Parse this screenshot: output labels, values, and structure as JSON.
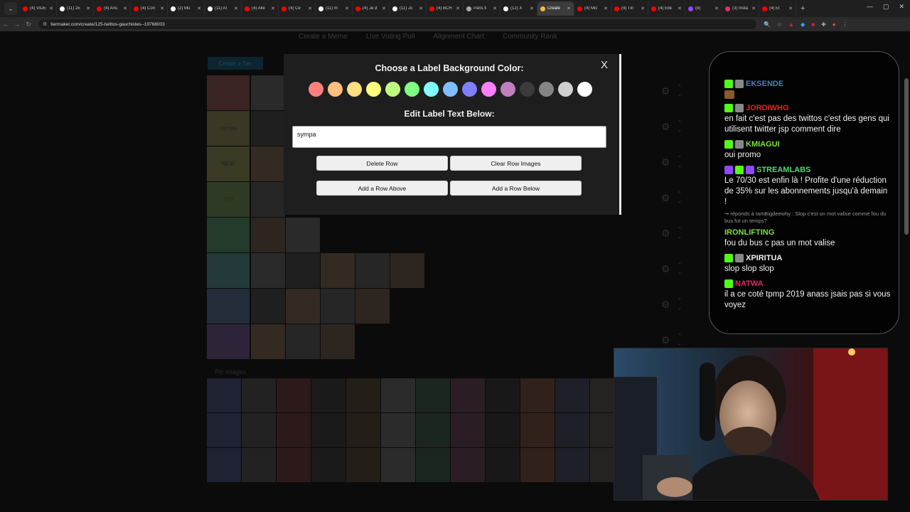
{
  "browser": {
    "tabs": [
      {
        "label": "(4) VIDE",
        "fav": "#ff0000"
      },
      {
        "label": "(11) 2E",
        "fav": "#ffffff"
      },
      {
        "label": "(4) Ans",
        "fav": "#ff0000"
      },
      {
        "label": "(4) Con",
        "fav": "#ff0000"
      },
      {
        "label": "(2) Mu",
        "fav": "#ffffff"
      },
      {
        "label": "(11) Al",
        "fav": "#ffffff"
      },
      {
        "label": "(4) Alle",
        "fav": "#ff0000"
      },
      {
        "label": "(4) Ce",
        "fav": "#ff0000"
      },
      {
        "label": "(11) m",
        "fav": "#ffffff"
      },
      {
        "label": "(4) Je d",
        "fav": "#ff0000"
      },
      {
        "label": "(11) Jo",
        "fav": "#ffffff"
      },
      {
        "label": "(4) BCH",
        "fav": "#ff0000"
      },
      {
        "label": "Paris fi",
        "fav": "#aaaaaa"
      },
      {
        "label": "(12) X",
        "fav": "#ffffff"
      },
      {
        "label": "Create",
        "fav": "#e8c03a",
        "active": true
      },
      {
        "label": "(4) Mic",
        "fav": "#ff0000"
      },
      {
        "label": "(4) Tin",
        "fav": "#ff0000"
      },
      {
        "label": "(4) Elle",
        "fav": "#ff0000"
      },
      {
        "label": "(8) ",
        "fav": "#9146ff"
      },
      {
        "label": "(3) Insta",
        "fav": "#e1306c"
      },
      {
        "label": "(4) Et",
        "fav": "#ff0000"
      }
    ],
    "new_tab": "+",
    "url": "tiermaker.com/create/125-twittos-gauchistes--19768003"
  },
  "page": {
    "top_links": [
      "Create a Meme",
      "Live Voting Poll",
      "Alignment Chart",
      "Community Rank"
    ],
    "create_tier_label": "Create a Tier",
    "pool_title": "Pic images"
  },
  "tiers": [
    {
      "label": "",
      "color": "#ff7f7f"
    },
    {
      "label": "sympa",
      "color": "#ffdf7f"
    },
    {
      "label": "NEW",
      "color": "#ffff7f"
    },
    {
      "label": "???",
      "color": "#bfff7f"
    },
    {
      "label": "",
      "color": "#7fff7f"
    },
    {
      "label": "",
      "color": "#7fffff"
    },
    {
      "label": "",
      "color": "#7fbfff"
    },
    {
      "label": "",
      "color": "#bf7fff"
    }
  ],
  "modal": {
    "close": "X",
    "title": "Choose a Label Background Color:",
    "edit_title": "Edit Label Text Below:",
    "label_value": "sympa",
    "buttons": {
      "delete_row": "Delete Row",
      "clear_images": "Clear Row Images",
      "add_above": "Add a Row Above",
      "add_below": "Add a Row Below"
    },
    "colors": [
      "#ff7f7f",
      "#ffbf7f",
      "#ffdf7f",
      "#ffff7f",
      "#bfff7f",
      "#7fff7f",
      "#7fffff",
      "#7fbfff",
      "#7f7fff",
      "#ff7fff",
      "#bf7fbf",
      "#3b3b3b",
      "#858585",
      "#cfcfcf",
      "#ffffff"
    ]
  },
  "chat": {
    "messages": [
      {
        "user": "EKSENDE",
        "color": "#4a7fc4",
        "badges": [
          "#53fc18",
          "#888888"
        ],
        "text": "",
        "emote": true
      },
      {
        "user": "JORDIWHO",
        "color": "#e02424",
        "badges": [
          "#53fc18",
          "#888888"
        ],
        "text": "en fait c'est pas des twittos c'est des gens qui utilisent twitter jsp comment dire"
      },
      {
        "user": "KMIAGUI",
        "color": "#79e23a",
        "badges": [
          "#53fc18",
          "#888888"
        ],
        "text": "oui promo"
      },
      {
        "user": "STREAMLABS",
        "color": "#5bd27a",
        "badges": [
          "#9146ff",
          "#53fc18",
          "#9146ff"
        ],
        "text": "Le 70/30 est enfin là ! Profite d'une réduction de 35% sur les abonnements jusqu'à demain !"
      },
      {
        "reply": "↪ réponds à IamBigdeewhy : Slop c'est un mot valise comme fou du bus fut un temps?",
        "user": "IRONLIFTING",
        "color": "#7be23a",
        "badges": [],
        "text": "fou du bus c pas un mot valise"
      },
      {
        "user": "XPIRITUA",
        "color": "#f2f2f2",
        "badges": [
          "#53fc18",
          "#888888"
        ],
        "text": "slop slop slop"
      },
      {
        "user": "NATWA",
        "color": "#e0246a",
        "badges": [
          "#53fc18"
        ],
        "text": "il a ce coté tpmp 2019 anass jsais pas si vous voyez"
      }
    ]
  }
}
